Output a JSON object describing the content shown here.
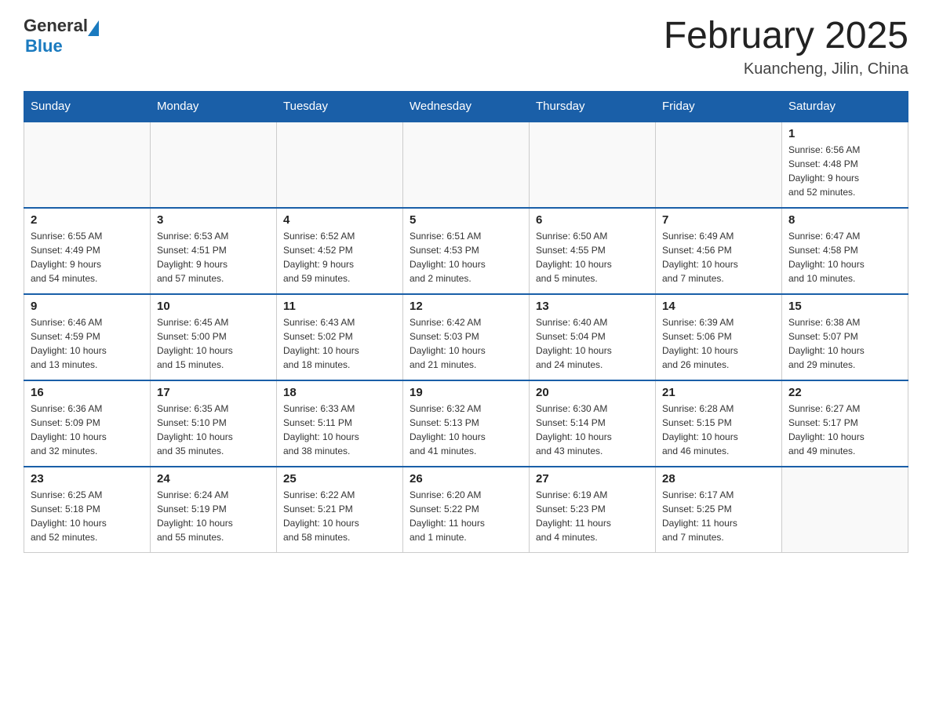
{
  "header": {
    "logo_general": "General",
    "logo_blue": "Blue",
    "title": "February 2025",
    "subtitle": "Kuancheng, Jilin, China"
  },
  "columns": [
    "Sunday",
    "Monday",
    "Tuesday",
    "Wednesday",
    "Thursday",
    "Friday",
    "Saturday"
  ],
  "weeks": [
    {
      "days": [
        {
          "num": "",
          "info": ""
        },
        {
          "num": "",
          "info": ""
        },
        {
          "num": "",
          "info": ""
        },
        {
          "num": "",
          "info": ""
        },
        {
          "num": "",
          "info": ""
        },
        {
          "num": "",
          "info": ""
        },
        {
          "num": "1",
          "info": "Sunrise: 6:56 AM\nSunset: 4:48 PM\nDaylight: 9 hours\nand 52 minutes."
        }
      ]
    },
    {
      "days": [
        {
          "num": "2",
          "info": "Sunrise: 6:55 AM\nSunset: 4:49 PM\nDaylight: 9 hours\nand 54 minutes."
        },
        {
          "num": "3",
          "info": "Sunrise: 6:53 AM\nSunset: 4:51 PM\nDaylight: 9 hours\nand 57 minutes."
        },
        {
          "num": "4",
          "info": "Sunrise: 6:52 AM\nSunset: 4:52 PM\nDaylight: 9 hours\nand 59 minutes."
        },
        {
          "num": "5",
          "info": "Sunrise: 6:51 AM\nSunset: 4:53 PM\nDaylight: 10 hours\nand 2 minutes."
        },
        {
          "num": "6",
          "info": "Sunrise: 6:50 AM\nSunset: 4:55 PM\nDaylight: 10 hours\nand 5 minutes."
        },
        {
          "num": "7",
          "info": "Sunrise: 6:49 AM\nSunset: 4:56 PM\nDaylight: 10 hours\nand 7 minutes."
        },
        {
          "num": "8",
          "info": "Sunrise: 6:47 AM\nSunset: 4:58 PM\nDaylight: 10 hours\nand 10 minutes."
        }
      ]
    },
    {
      "days": [
        {
          "num": "9",
          "info": "Sunrise: 6:46 AM\nSunset: 4:59 PM\nDaylight: 10 hours\nand 13 minutes."
        },
        {
          "num": "10",
          "info": "Sunrise: 6:45 AM\nSunset: 5:00 PM\nDaylight: 10 hours\nand 15 minutes."
        },
        {
          "num": "11",
          "info": "Sunrise: 6:43 AM\nSunset: 5:02 PM\nDaylight: 10 hours\nand 18 minutes."
        },
        {
          "num": "12",
          "info": "Sunrise: 6:42 AM\nSunset: 5:03 PM\nDaylight: 10 hours\nand 21 minutes."
        },
        {
          "num": "13",
          "info": "Sunrise: 6:40 AM\nSunset: 5:04 PM\nDaylight: 10 hours\nand 24 minutes."
        },
        {
          "num": "14",
          "info": "Sunrise: 6:39 AM\nSunset: 5:06 PM\nDaylight: 10 hours\nand 26 minutes."
        },
        {
          "num": "15",
          "info": "Sunrise: 6:38 AM\nSunset: 5:07 PM\nDaylight: 10 hours\nand 29 minutes."
        }
      ]
    },
    {
      "days": [
        {
          "num": "16",
          "info": "Sunrise: 6:36 AM\nSunset: 5:09 PM\nDaylight: 10 hours\nand 32 minutes."
        },
        {
          "num": "17",
          "info": "Sunrise: 6:35 AM\nSunset: 5:10 PM\nDaylight: 10 hours\nand 35 minutes."
        },
        {
          "num": "18",
          "info": "Sunrise: 6:33 AM\nSunset: 5:11 PM\nDaylight: 10 hours\nand 38 minutes."
        },
        {
          "num": "19",
          "info": "Sunrise: 6:32 AM\nSunset: 5:13 PM\nDaylight: 10 hours\nand 41 minutes."
        },
        {
          "num": "20",
          "info": "Sunrise: 6:30 AM\nSunset: 5:14 PM\nDaylight: 10 hours\nand 43 minutes."
        },
        {
          "num": "21",
          "info": "Sunrise: 6:28 AM\nSunset: 5:15 PM\nDaylight: 10 hours\nand 46 minutes."
        },
        {
          "num": "22",
          "info": "Sunrise: 6:27 AM\nSunset: 5:17 PM\nDaylight: 10 hours\nand 49 minutes."
        }
      ]
    },
    {
      "days": [
        {
          "num": "23",
          "info": "Sunrise: 6:25 AM\nSunset: 5:18 PM\nDaylight: 10 hours\nand 52 minutes."
        },
        {
          "num": "24",
          "info": "Sunrise: 6:24 AM\nSunset: 5:19 PM\nDaylight: 10 hours\nand 55 minutes."
        },
        {
          "num": "25",
          "info": "Sunrise: 6:22 AM\nSunset: 5:21 PM\nDaylight: 10 hours\nand 58 minutes."
        },
        {
          "num": "26",
          "info": "Sunrise: 6:20 AM\nSunset: 5:22 PM\nDaylight: 11 hours\nand 1 minute."
        },
        {
          "num": "27",
          "info": "Sunrise: 6:19 AM\nSunset: 5:23 PM\nDaylight: 11 hours\nand 4 minutes."
        },
        {
          "num": "28",
          "info": "Sunrise: 6:17 AM\nSunset: 5:25 PM\nDaylight: 11 hours\nand 7 minutes."
        },
        {
          "num": "",
          "info": ""
        }
      ]
    }
  ]
}
